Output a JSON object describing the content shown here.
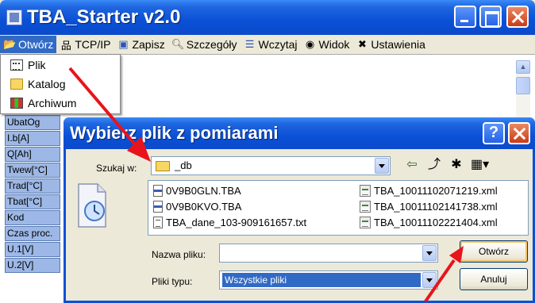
{
  "main_window": {
    "title": "TBA_Starter v2.0"
  },
  "menubar": {
    "items": [
      {
        "label": "Otwórz",
        "icon": "folder-open-icon",
        "active": true
      },
      {
        "label": "TCP/IP",
        "icon": "network-icon"
      },
      {
        "label": "Zapisz",
        "icon": "save-icon"
      },
      {
        "label": "Szczegóły",
        "icon": "magnifier-icon"
      },
      {
        "label": "Wczytaj",
        "icon": "list-icon"
      },
      {
        "label": "Widok",
        "icon": "eye-icon"
      },
      {
        "label": "Ustawienia",
        "icon": "tools-icon"
      }
    ]
  },
  "open_menu": {
    "items": [
      {
        "label": "Plik",
        "icon": "file-icon"
      },
      {
        "label": "Katalog",
        "icon": "folder-icon"
      },
      {
        "label": "Archiwum",
        "icon": "archive-icon"
      }
    ]
  },
  "left_list": {
    "items": [
      "UbatOg",
      "I.b[A]",
      "Q[Ah]",
      "Twew[°C]",
      "Trad[°C]",
      "Tbat[°C]",
      "Kod",
      "Czas proc.",
      "U.1[V]",
      "U.2[V]"
    ]
  },
  "dialog": {
    "title": "Wybierz plik z pomiarami",
    "help_label": "?",
    "lookin_label": "Szukaj w:",
    "lookin_value": "_db",
    "files": [
      {
        "name": "0V9B0GLN.TBA",
        "type": "tba"
      },
      {
        "name": "0V9B0KVO.TBA",
        "type": "tba"
      },
      {
        "name": "TBA_dane_103-909161657.txt",
        "type": "txt"
      },
      {
        "name": "TBA_10011102071219.xml",
        "type": "xml"
      },
      {
        "name": "TBA_10011102141738.xml",
        "type": "xml"
      },
      {
        "name": "TBA_10011102221404.xml",
        "type": "xml"
      }
    ],
    "filename_label": "Nazwa pliku:",
    "filename_value": "",
    "filetype_label": "Pliki typu:",
    "filetype_value": "Wszystkie pliki",
    "open_button": "Otwórz",
    "cancel_button": "Anuluj"
  },
  "colors": {
    "titlebar_blue": "#0A50D6",
    "selection_blue": "#316AC5",
    "arrow_red": "#E8141C",
    "list_blue": "#9DB8E6"
  }
}
